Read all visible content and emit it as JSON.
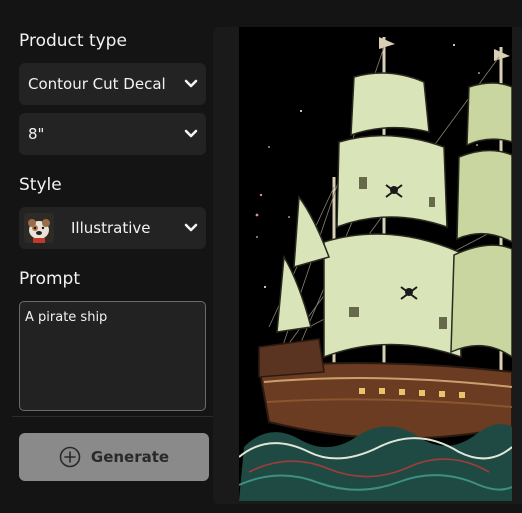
{
  "product_type": {
    "label": "Product type",
    "type_value": "Contour Cut Decal",
    "size_value": "8\""
  },
  "style": {
    "label": "Style",
    "value": "Illustrative",
    "avatar_icon": "bulldog-avatar"
  },
  "prompt": {
    "label": "Prompt",
    "value": "A pirate ship"
  },
  "generate": {
    "label": "Generate",
    "icon": "plus-circle-icon"
  },
  "preview": {
    "subject": "pirate-ship-illustration"
  },
  "colors": {
    "background": "#141414",
    "field": "#232323",
    "button": "#8a8a8a",
    "sail": "#d9e4b8",
    "hull": "#6b3b22",
    "wave": "#3f8f7f"
  }
}
